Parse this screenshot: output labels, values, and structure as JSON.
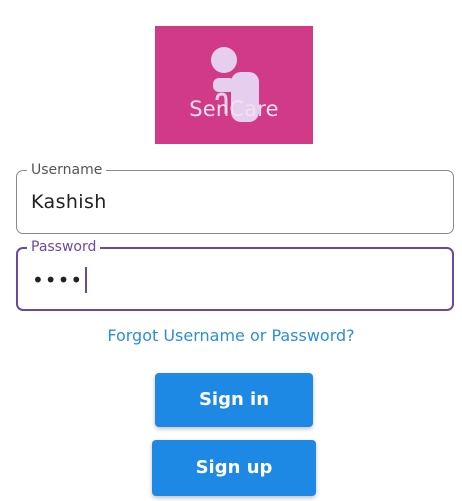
{
  "logo": {
    "text": "SenCare",
    "background_color": "#d13a86",
    "icon": "elderly-person-with-cane-icon"
  },
  "form": {
    "username": {
      "label": "Username",
      "value": "Kashish"
    },
    "password": {
      "label": "Password",
      "masked_value": "••••"
    },
    "forgot_link": "Forgot Username or Password?",
    "signin_label": "Sign in",
    "signup_label": "Sign up"
  },
  "colors": {
    "accent_purple": "#6a4a9c",
    "link_blue": "#2a8fd8",
    "button_blue": "#1e88e5"
  }
}
